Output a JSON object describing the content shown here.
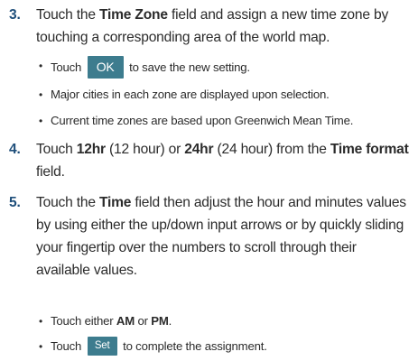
{
  "steps": [
    {
      "number": "3.",
      "segments": [
        {
          "t": "Touch the "
        },
        {
          "t": "Time Zone",
          "b": true
        },
        {
          "t": " field and assign a new time zone by touching a corresponding area of the world map."
        }
      ],
      "bullets": [
        {
          "before": "Touch ",
          "button": "OK",
          "after": " to save the new setting."
        },
        {
          "text": "Major cities in each zone are displayed upon selection."
        },
        {
          "text": "Current time zones are based upon Greenwich Mean Time."
        }
      ]
    },
    {
      "number": "4.",
      "segments": [
        {
          "t": "Touch "
        },
        {
          "t": "12hr",
          "b": true
        },
        {
          "t": " (12 hour) or "
        },
        {
          "t": "24hr",
          "b": true
        },
        {
          "t": " (24 hour) from the "
        },
        {
          "t": "Time format",
          "b": true
        },
        {
          "t": " field."
        }
      ]
    },
    {
      "number": "5.",
      "segments": [
        {
          "t": "Touch the "
        },
        {
          "t": "Time",
          "b": true
        },
        {
          "t": " field then adjust the hour and minutes values by using either the up/down input arrows or by quickly sliding your fingertip over the numbers to scroll through their available values."
        }
      ],
      "bullets": [
        {
          "before": "Touch either ",
          "b1": "AM",
          "mid": " or ",
          "b2": "PM",
          "after": "."
        },
        {
          "before": "Touch ",
          "button": "Set",
          "after": " to complete the assignment."
        }
      ]
    }
  ]
}
